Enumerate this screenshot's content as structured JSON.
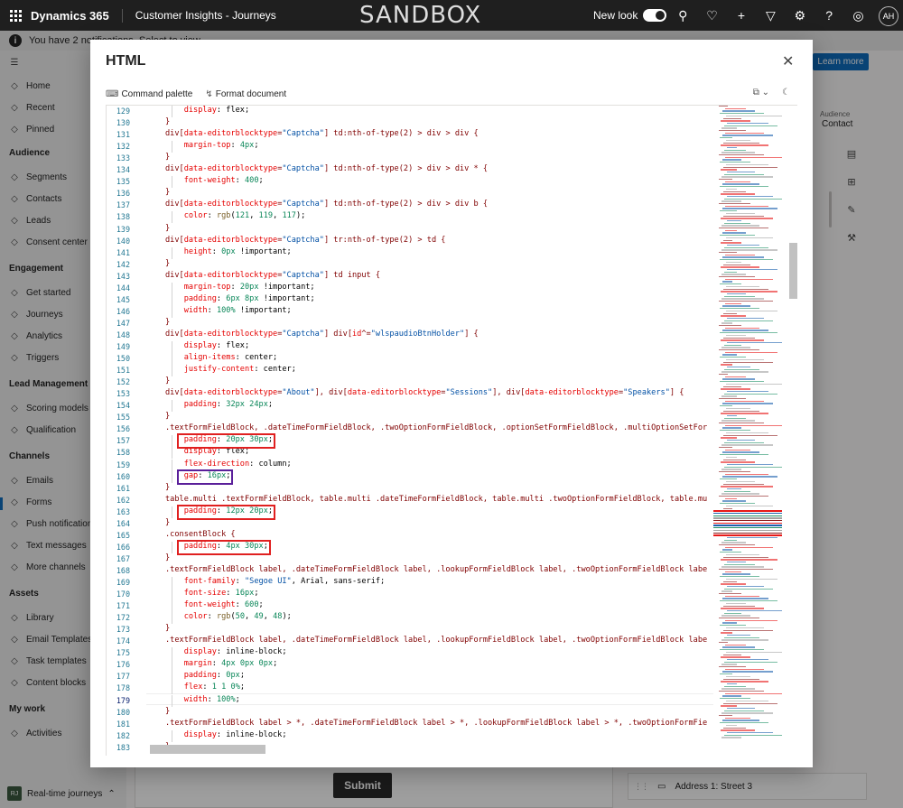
{
  "topbar": {
    "brand": "Dynamics 365",
    "app": "Customer Insights - Journeys",
    "environment": "SANDBOX",
    "new_look_label": "New look",
    "new_look_on": true,
    "icons": [
      "search-icon",
      "lightbulb-icon",
      "plus-icon",
      "filter-icon",
      "settings-icon",
      "help-icon",
      "copilot-icon"
    ],
    "user_initials": "AH"
  },
  "notification": {
    "text": "You have 2 notifications. Select to view."
  },
  "sidebar": {
    "nav": [
      {
        "label": "Home",
        "icon": "home-icon"
      },
      {
        "label": "Recent",
        "icon": "clock-icon"
      },
      {
        "label": "Pinned",
        "icon": "pin-icon"
      }
    ],
    "groups": [
      {
        "title": "Audience",
        "items": [
          "Segments",
          "Contacts",
          "Leads",
          "Consent center"
        ]
      },
      {
        "title": "Engagement",
        "items": [
          "Get started",
          "Journeys",
          "Analytics",
          "Triggers"
        ]
      },
      {
        "title": "Lead Management",
        "items": [
          "Scoring models",
          "Qualification"
        ]
      },
      {
        "title": "Channels",
        "items": [
          "Emails",
          "Forms",
          "Push notifications",
          "Text messages",
          "More channels"
        ]
      },
      {
        "title": "Assets",
        "items": [
          "Library",
          "Email Templates",
          "Task templates",
          "Content blocks"
        ]
      },
      {
        "title": "My work",
        "items": [
          "Activities"
        ]
      }
    ],
    "active_item": "Forms",
    "area_switcher": {
      "initials": "RJ",
      "label": "Real-time journeys"
    }
  },
  "background": {
    "learn_more": "Learn more",
    "audience_label": "Audience",
    "audience_value": "Contact",
    "submit_label": "Submit",
    "field_item": "Address 1: Street 3"
  },
  "modal": {
    "title": "HTML",
    "toolbar": {
      "command_palette": "Command palette",
      "format_document": "Format document"
    },
    "active_line": 179,
    "lines": [
      {
        "n": 129,
        "t": "    display: flex;"
      },
      {
        "n": 130,
        "t": "}"
      },
      {
        "n": 131,
        "t": "div[data-editorblocktype=\"Captcha\"] td:nth-of-type(2) > div > div {"
      },
      {
        "n": 132,
        "t": "    margin-top: 4px;"
      },
      {
        "n": 133,
        "t": "}"
      },
      {
        "n": 134,
        "t": "div[data-editorblocktype=\"Captcha\"] td:nth-of-type(2) > div > div * {"
      },
      {
        "n": 135,
        "t": "    font-weight: 400;"
      },
      {
        "n": 136,
        "t": "}"
      },
      {
        "n": 137,
        "t": "div[data-editorblocktype=\"Captcha\"] td:nth-of-type(2) > div > div b {"
      },
      {
        "n": 138,
        "t": "    color: rgb(121, 119, 117);"
      },
      {
        "n": 139,
        "t": "}"
      },
      {
        "n": 140,
        "t": "div[data-editorblocktype=\"Captcha\"] tr:nth-of-type(2) > td {"
      },
      {
        "n": 141,
        "t": "    height: 0px !important;"
      },
      {
        "n": 142,
        "t": "}"
      },
      {
        "n": 143,
        "t": "div[data-editorblocktype=\"Captcha\"] td input {"
      },
      {
        "n": 144,
        "t": "    margin-top: 20px !important;"
      },
      {
        "n": 145,
        "t": "    padding: 6px 8px !important;"
      },
      {
        "n": 146,
        "t": "    width: 100% !important;"
      },
      {
        "n": 147,
        "t": "}"
      },
      {
        "n": 148,
        "t": "div[data-editorblocktype=\"Captcha\"] div[id^=\"wlspaudioBtnHolder\"] {"
      },
      {
        "n": 149,
        "t": "    display: flex;"
      },
      {
        "n": 150,
        "t": "    align-items: center;"
      },
      {
        "n": 151,
        "t": "    justify-content: center;"
      },
      {
        "n": 152,
        "t": "}"
      },
      {
        "n": 153,
        "t": "div[data-editorblocktype=\"About\"], div[data-editorblocktype=\"Sessions\"], div[data-editorblocktype=\"Speakers\"] {"
      },
      {
        "n": 154,
        "t": "    padding: 32px 24px;"
      },
      {
        "n": 155,
        "t": "}"
      },
      {
        "n": 156,
        "t": ".textFormFieldBlock, .dateTimeFormFieldBlock, .twoOptionFormFieldBlock, .optionSetFormFieldBlock, .multiOptionSetFor"
      },
      {
        "n": 157,
        "t": "    padding: 20px 30px;"
      },
      {
        "n": 158,
        "t": "    display: flex;"
      },
      {
        "n": 159,
        "t": "    flex-direction: column;"
      },
      {
        "n": 160,
        "t": "    gap: 16px;"
      },
      {
        "n": 161,
        "t": "}"
      },
      {
        "n": 162,
        "t": "table.multi .textFormFieldBlock, table.multi .dateTimeFormFieldBlock, table.multi .twoOptionFormFieldBlock, table.mu"
      },
      {
        "n": 163,
        "t": "    padding: 12px 20px;"
      },
      {
        "n": 164,
        "t": "}"
      },
      {
        "n": 165,
        "t": ".consentBlock {"
      },
      {
        "n": 166,
        "t": "    padding: 4px 30px;"
      },
      {
        "n": 167,
        "t": "}"
      },
      {
        "n": 168,
        "t": ".textFormFieldBlock label, .dateTimeFormFieldBlock label, .lookupFormFieldBlock label, .twoOptionFormFieldBlock labe"
      },
      {
        "n": 169,
        "t": "    font-family: \"Segoe UI\", Arial, sans-serif;"
      },
      {
        "n": 170,
        "t": "    font-size: 16px;"
      },
      {
        "n": 171,
        "t": "    font-weight: 600;"
      },
      {
        "n": 172,
        "t": "    color: rgb(50, 49, 48);"
      },
      {
        "n": 173,
        "t": "}"
      },
      {
        "n": 174,
        "t": ".textFormFieldBlock label, .dateTimeFormFieldBlock label, .lookupFormFieldBlock label, .twoOptionFormFieldBlock labe"
      },
      {
        "n": 175,
        "t": "    display: inline-block;"
      },
      {
        "n": 176,
        "t": "    margin: 4px 0px 0px;"
      },
      {
        "n": 177,
        "t": "    padding: 0px;"
      },
      {
        "n": 178,
        "t": "    flex: 1 1 0%;"
      },
      {
        "n": 179,
        "t": "    width: 100%;"
      },
      {
        "n": 180,
        "t": "}"
      },
      {
        "n": 181,
        "t": ".textFormFieldBlock label > *, .dateTimeFormFieldBlock label > *, .lookupFormFieldBlock label > *, .twoOptionFormFie"
      },
      {
        "n": 182,
        "t": "    display: inline-block;"
      },
      {
        "n": 183,
        "t": "}"
      }
    ],
    "highlights": [
      {
        "line": 157,
        "color": "#e02020"
      },
      {
        "line": 160,
        "color": "#5a1f9a"
      },
      {
        "line": 163,
        "color": "#e02020"
      },
      {
        "line": 166,
        "color": "#e02020"
      }
    ]
  }
}
